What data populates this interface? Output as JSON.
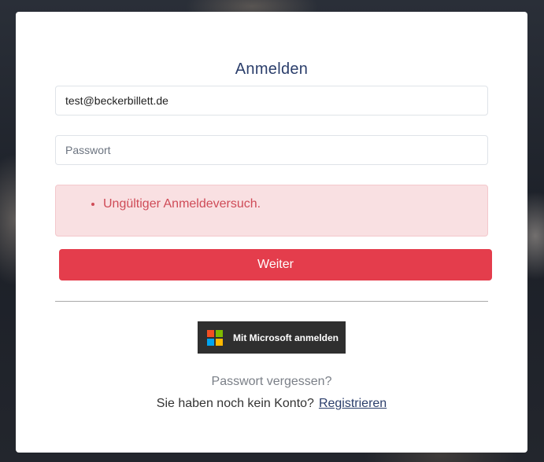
{
  "login": {
    "title": "Anmelden",
    "email_value": "test@beckerbillett.de",
    "password_placeholder": "Passwort",
    "error_message": "Ungültiger Anmeldeversuch.",
    "submit_label": "Weiter",
    "microsoft_label": "Mit Microsoft anmelden",
    "forgot_password": "Passwort vergessen?",
    "no_account_text": "Sie haben noch kein Konto?",
    "register_link": "Registrieren"
  },
  "colors": {
    "title": "#2b3e6b",
    "primary_button": "#e43d4c",
    "error_bg": "#f9e0e2",
    "error_text": "#cf4b57",
    "ms_button_bg": "#2f2f2f",
    "ms_red": "#f25022",
    "ms_green": "#7fba00",
    "ms_blue": "#00a4ef",
    "ms_yellow": "#ffb900"
  },
  "icons": {
    "microsoft": "microsoft-logo-icon"
  }
}
